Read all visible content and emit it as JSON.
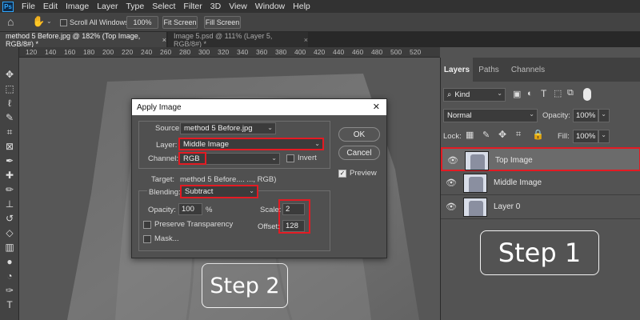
{
  "app": {
    "logo": "Ps"
  },
  "menu": [
    "File",
    "Edit",
    "Image",
    "Layer",
    "Type",
    "Select",
    "Filter",
    "3D",
    "View",
    "Window",
    "Help"
  ],
  "options": {
    "scroll_all_label": "Scroll All Windows",
    "zoom_value": "100%",
    "fit_screen": "Fit Screen",
    "fill_screen": "Fill Screen"
  },
  "tabs": [
    {
      "label": "method 5 Before.jpg @ 182% (Top Image, RGB/8#) *",
      "close": "×"
    },
    {
      "label": "Image 5.psd @ 111% (Layer 5, RGB/8#) *",
      "close": "×"
    }
  ],
  "ruler_ticks": [
    "120",
    "140",
    "160",
    "180",
    "200",
    "220",
    "240",
    "260",
    "280",
    "300",
    "320",
    "340",
    "360",
    "380",
    "400",
    "420",
    "440",
    "460",
    "480",
    "500",
    "520"
  ],
  "dialog": {
    "title": "Apply Image",
    "close": "✕",
    "source_label": "Source:",
    "source_value": "method 5 Before.jpg",
    "layer_label": "Layer:",
    "layer_value": "Middle Image",
    "channel_label": "Channel:",
    "channel_value": "RGB",
    "invert_label": "Invert",
    "target_label": "Target:",
    "target_value": "method 5 Before.... ..., RGB)",
    "blending_label": "Blending:",
    "blending_value": "Subtract",
    "opacity_label": "Opacity:",
    "opacity_value": "100",
    "opacity_unit": "%",
    "scale_label": "Scale:",
    "scale_value": "2",
    "offset_label": "Offset:",
    "offset_value": "128",
    "preserve_label": "Preserve Transparency",
    "mask_label": "Mask...",
    "ok": "OK",
    "cancel": "Cancel",
    "preview_label": "Preview",
    "preview_checked": true
  },
  "layers_panel": {
    "tabs": [
      "Layers",
      "Paths",
      "Channels"
    ],
    "kind_label": "Kind",
    "blend_mode": "Normal",
    "opacity_label": "Opacity:",
    "opacity_value": "100%",
    "lock_label": "Lock:",
    "fill_label": "Fill:",
    "fill_value": "100%",
    "layers": [
      {
        "name": "Top Image",
        "selected": true
      },
      {
        "name": "Middle Image",
        "selected": false
      },
      {
        "name": "Layer 0",
        "selected": false
      }
    ]
  },
  "annotations": {
    "step1": "Step 1",
    "step2": "Step 2"
  },
  "colors": {
    "highlight": "#e31b23",
    "accent": "#31a8ff"
  }
}
